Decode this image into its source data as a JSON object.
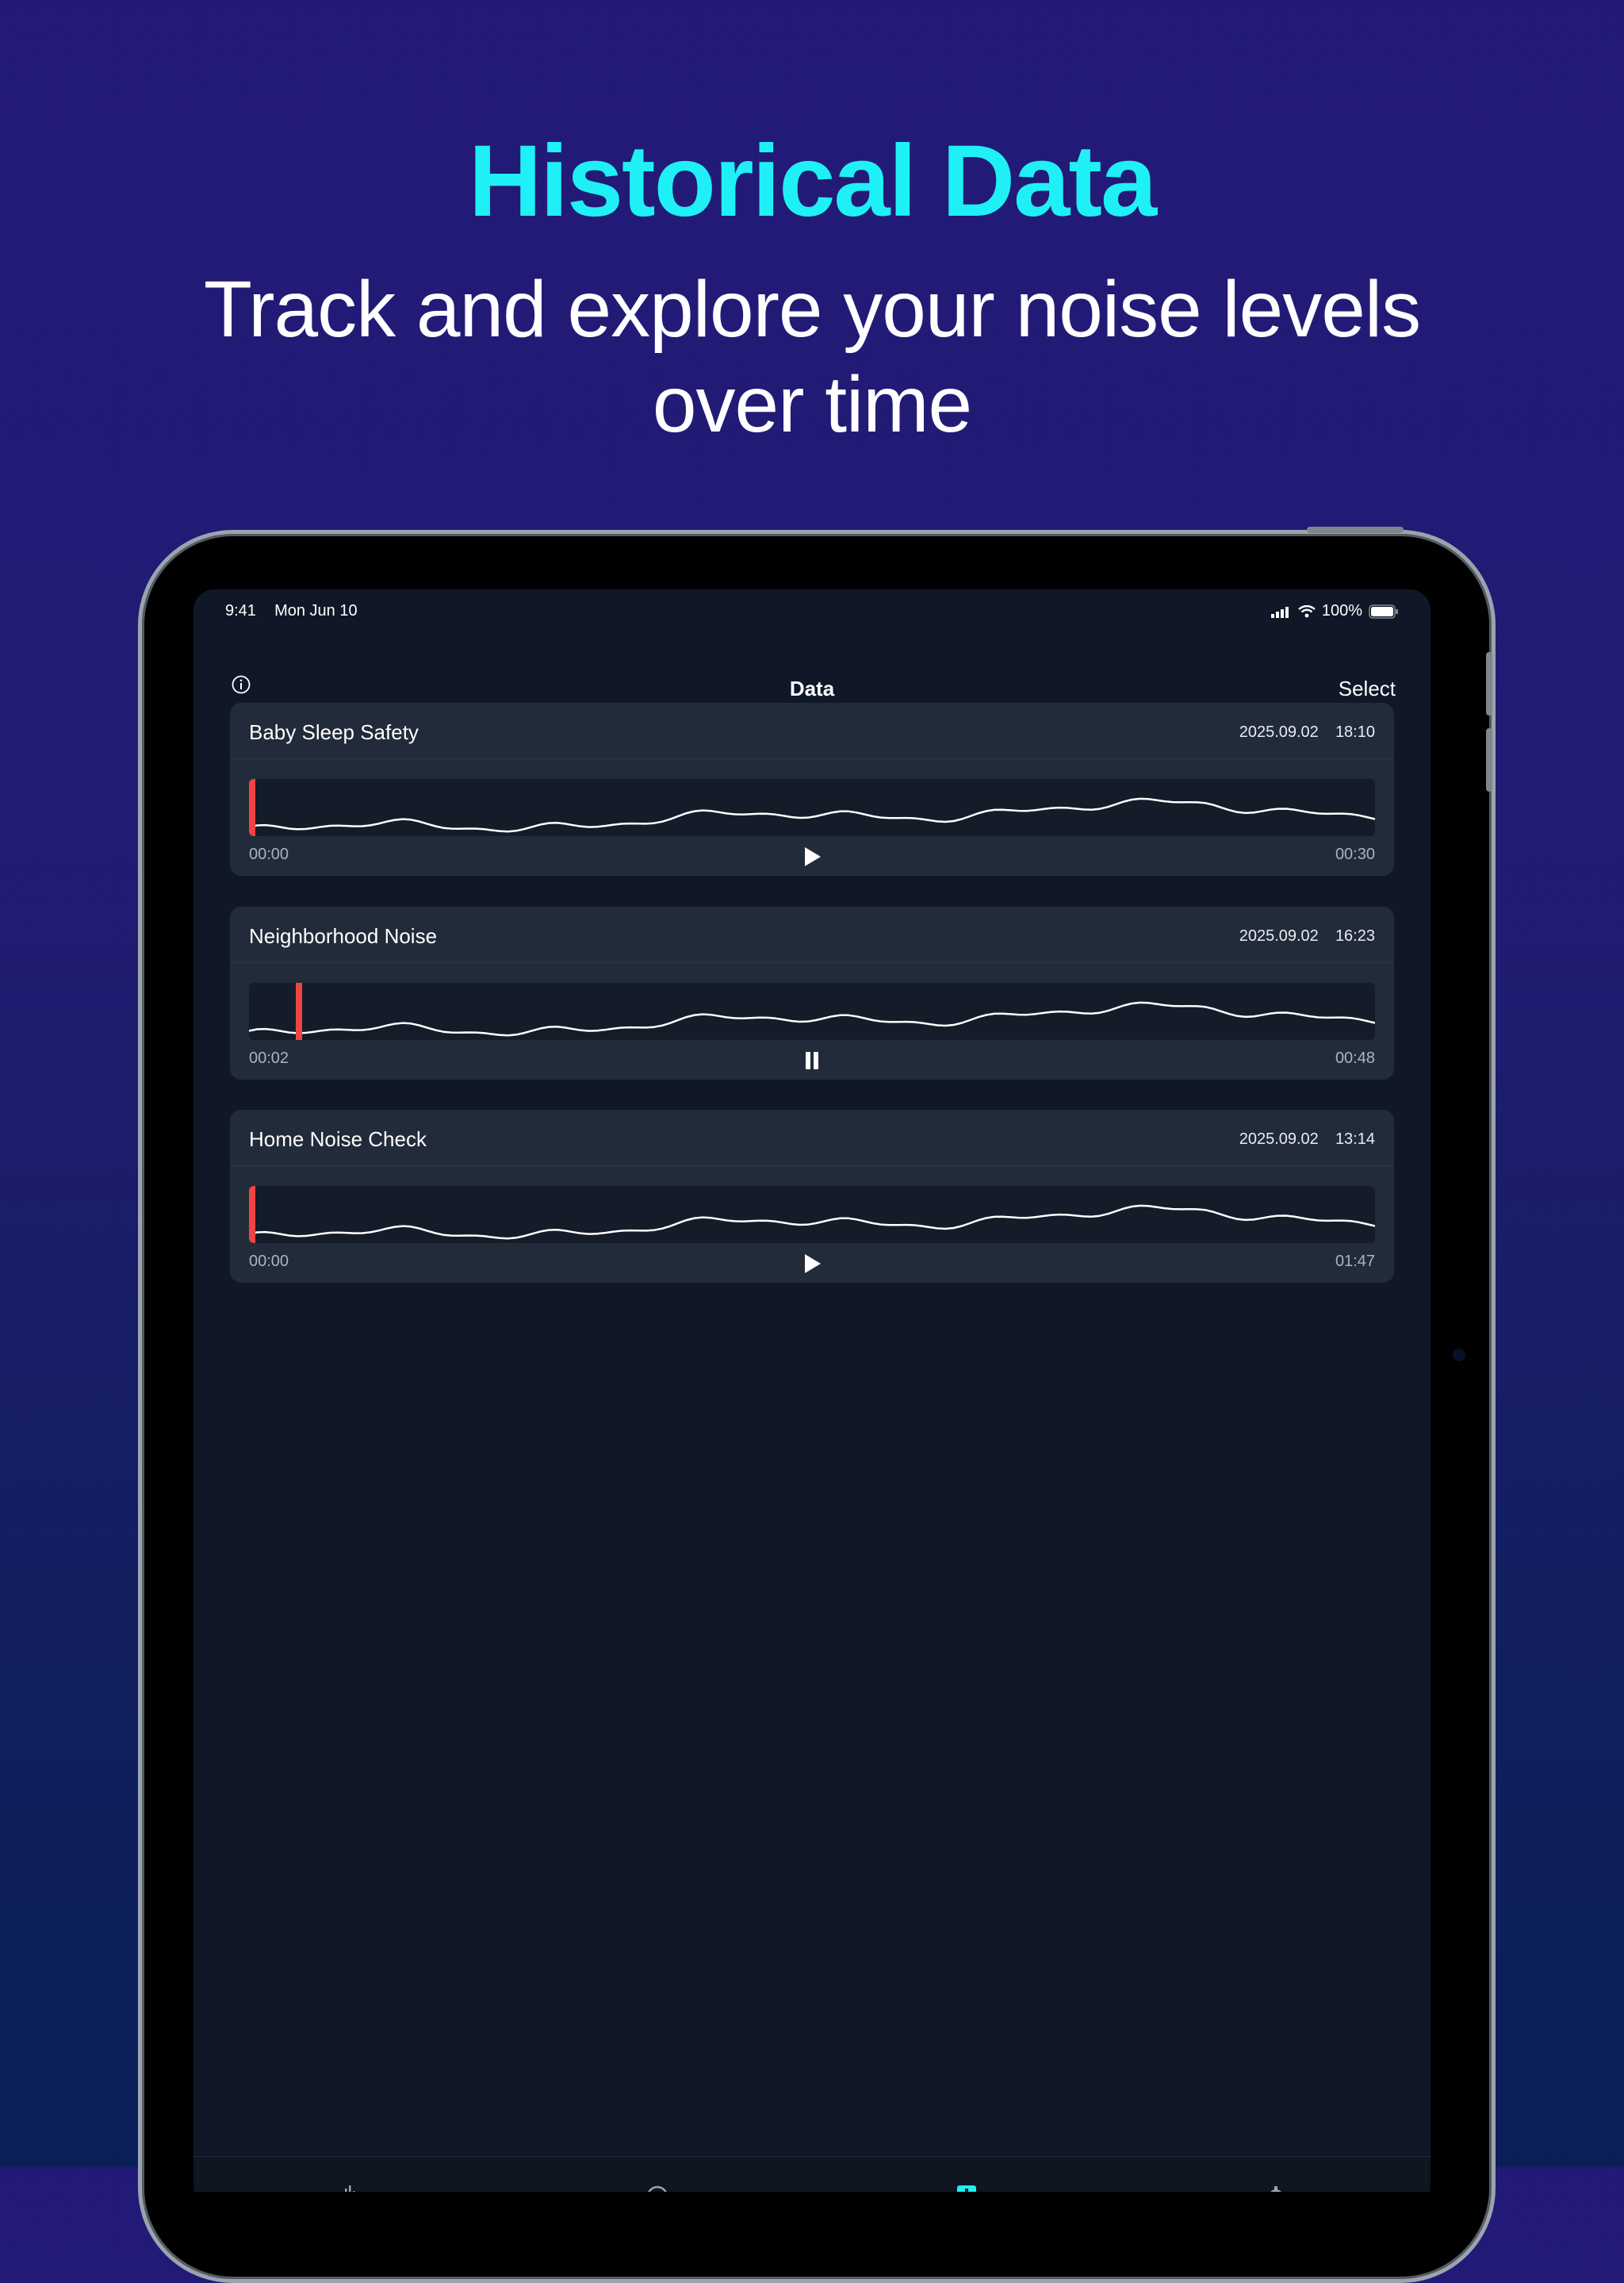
{
  "marketing": {
    "headline": "Historical Data",
    "subheadline": "Track and explore your noise levels over time"
  },
  "status_bar": {
    "time": "9:41",
    "date": "Mon Jun 10",
    "battery": "100%"
  },
  "nav": {
    "title": "Data",
    "select_label": "Select"
  },
  "recordings": [
    {
      "name": "Baby Sleep Safety",
      "date": "2025.09.02",
      "time": "18:10",
      "start_time": "00:00",
      "end_time": "00:30",
      "state": "play",
      "progress": 0.0
    },
    {
      "name": "Neighborhood Noise",
      "date": "2025.09.02",
      "time": "16:23",
      "start_time": "00:02",
      "end_time": "00:48",
      "state": "pause",
      "progress": 0.0417
    },
    {
      "name": "Home Noise Check",
      "date": "2025.09.02",
      "time": "13:14",
      "start_time": "00:00",
      "end_time": "01:47",
      "state": "play",
      "progress": 0.0
    }
  ],
  "colors": {
    "headline": "#1ff0f5",
    "playhead": "#ef4444",
    "tab_active": "#1ff0f5"
  },
  "tabs": [
    "waveform-icon",
    "meter-icon",
    "data-icon",
    "settings-icon"
  ]
}
